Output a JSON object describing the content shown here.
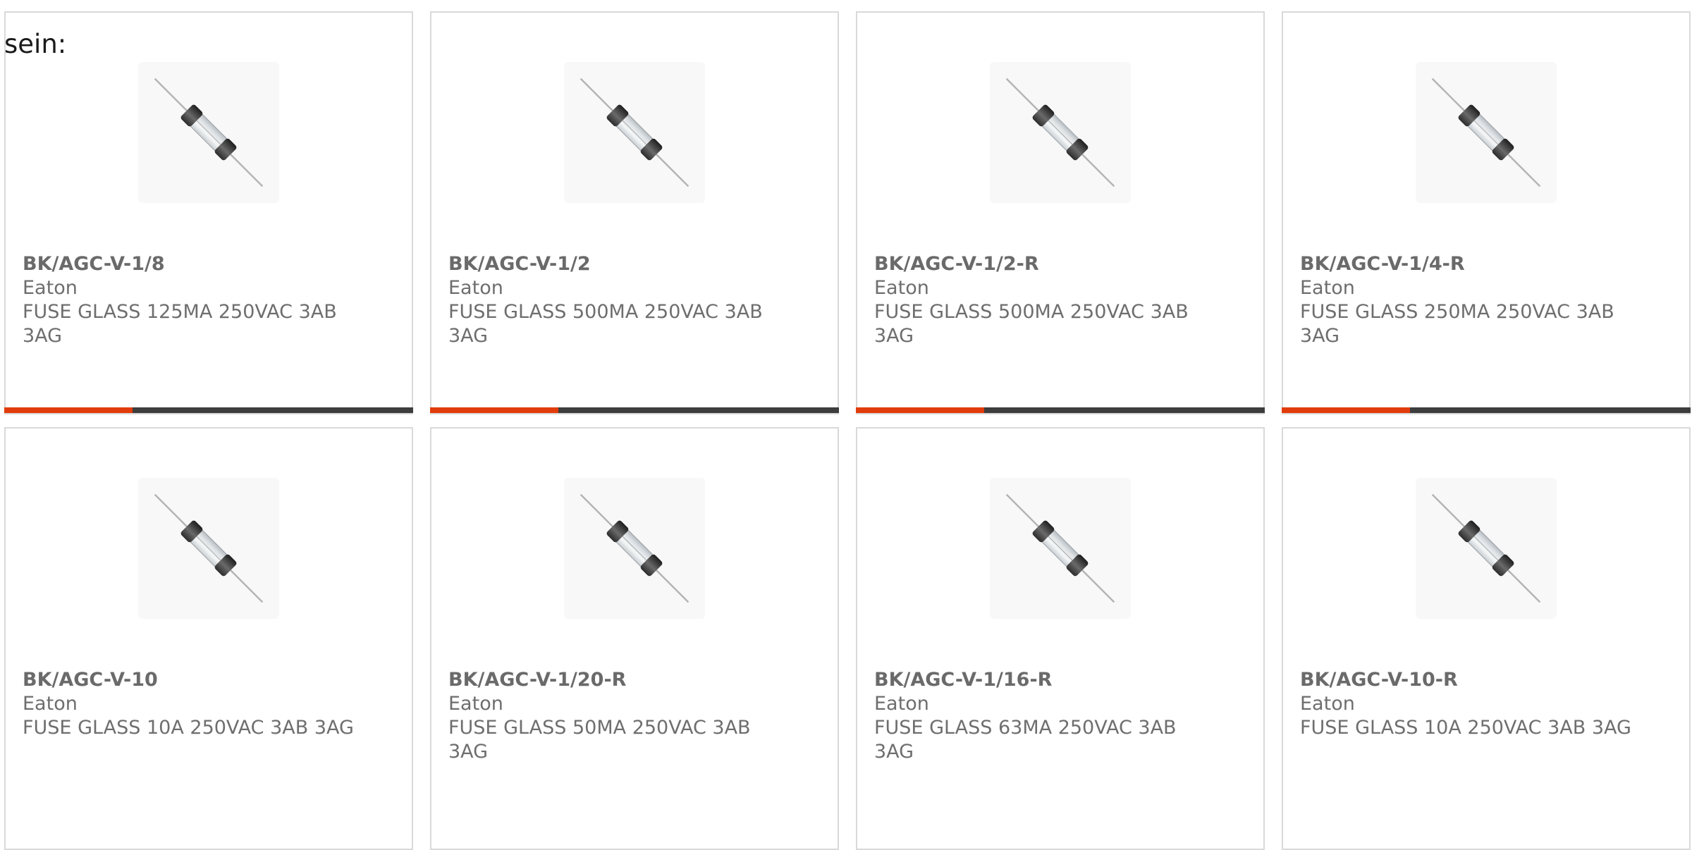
{
  "intro_text": "sein:",
  "accent_color": "#e23c0a",
  "bar_color": "#3d3d3d",
  "image_icon": "glass-fuse-icon",
  "products": [
    {
      "part": "BK/AGC-V-1/8",
      "maker": "Eaton",
      "desc": "FUSE GLASS 125MA 250VAC 3AB 3AG"
    },
    {
      "part": "BK/AGC-V-1/2",
      "maker": "Eaton",
      "desc": "FUSE GLASS 500MA 250VAC 3AB 3AG"
    },
    {
      "part": "BK/AGC-V-1/2-R",
      "maker": "Eaton",
      "desc": "FUSE GLASS 500MA 250VAC 3AB 3AG"
    },
    {
      "part": "BK/AGC-V-1/4-R",
      "maker": "Eaton",
      "desc": "FUSE GLASS 250MA 250VAC 3AB 3AG"
    },
    {
      "part": "BK/AGC-V-10",
      "maker": "Eaton",
      "desc": "FUSE GLASS 10A 250VAC 3AB 3AG"
    },
    {
      "part": "BK/AGC-V-1/20-R",
      "maker": "Eaton",
      "desc": "FUSE GLASS 50MA 250VAC 3AB 3AG"
    },
    {
      "part": "BK/AGC-V-1/16-R",
      "maker": "Eaton",
      "desc": "FUSE GLASS 63MA 250VAC 3AB 3AG"
    },
    {
      "part": "BK/AGC-V-10-R",
      "maker": "Eaton",
      "desc": "FUSE GLASS 10A 250VAC 3AB 3AG"
    }
  ]
}
